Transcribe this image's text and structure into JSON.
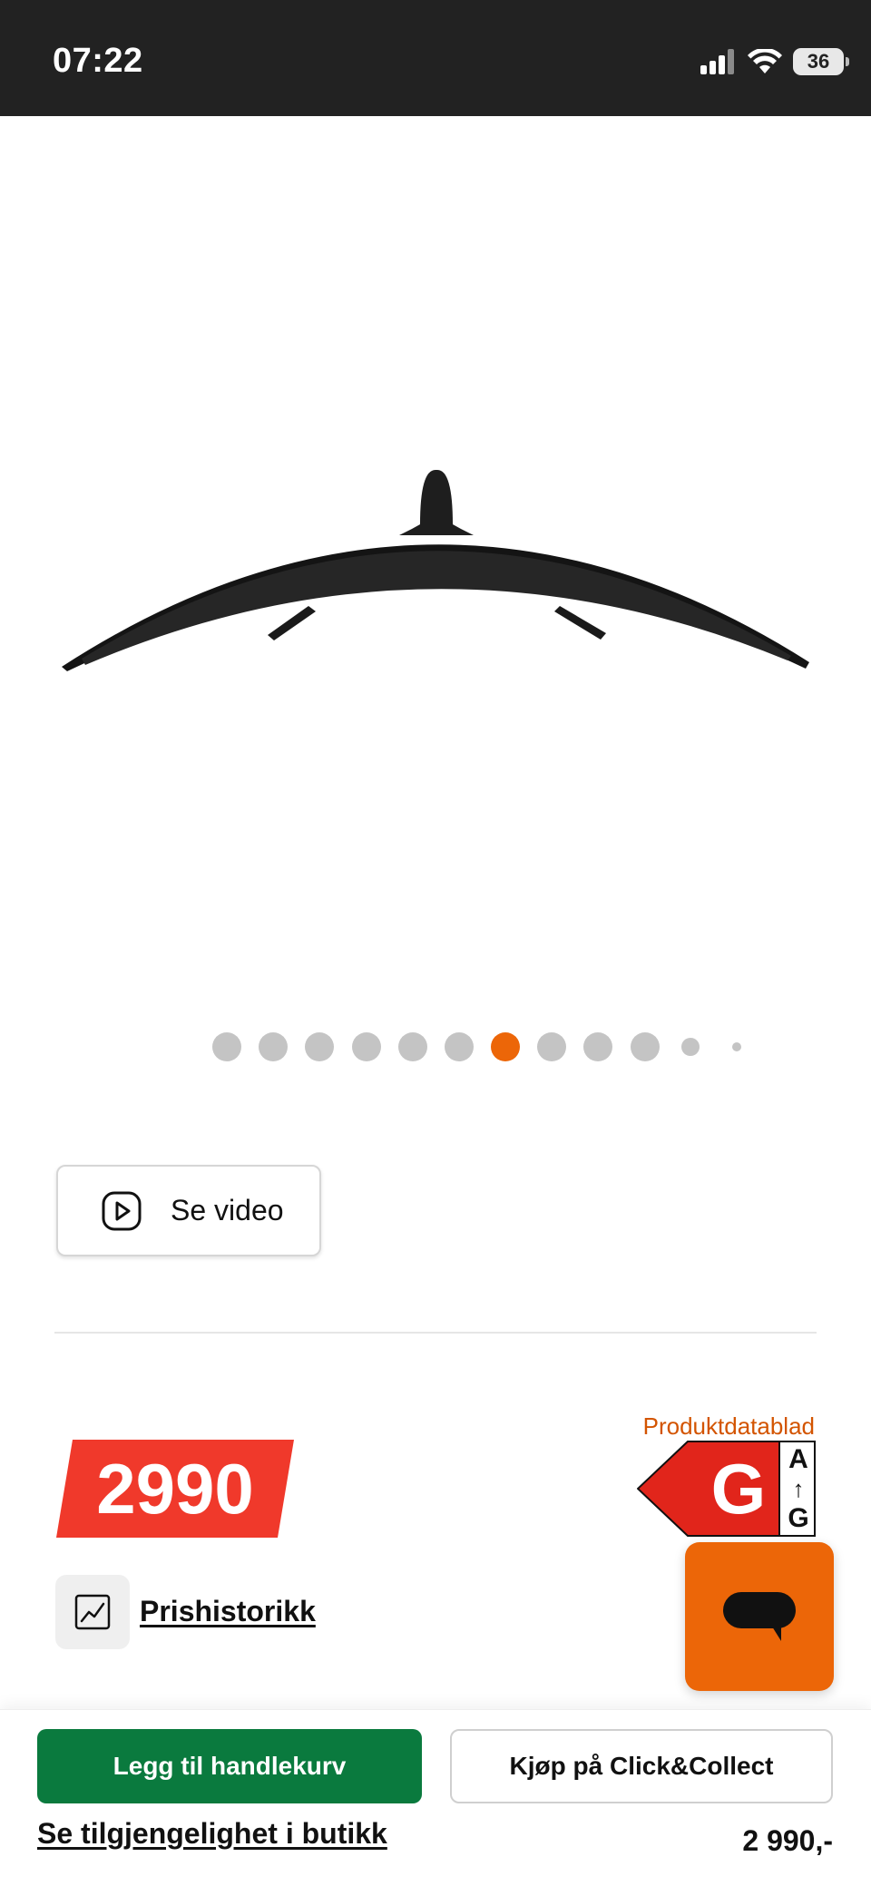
{
  "status_bar": {
    "time": "07:22",
    "battery": "36",
    "icons": [
      "signal-icon",
      "wifi-icon",
      "battery-icon"
    ]
  },
  "gallery": {
    "image": "curved-monitor-top-view",
    "dot_count": 12,
    "active_index": 6
  },
  "video_button": {
    "label": "Se video",
    "icon": "play-icon"
  },
  "price": {
    "value": "2990",
    "tag_color": "#f0392b"
  },
  "energy": {
    "datasheet_link": "Produktdatablad",
    "class": "G",
    "scale_top": "A",
    "scale_arrow": "↑",
    "scale_bottom": "G",
    "color": "#e1251b"
  },
  "price_history": {
    "label": "Prishistorikk",
    "icon": "chart-line-icon"
  },
  "chat": {
    "icon": "chat-bubble-icon",
    "color": "#ec6608"
  },
  "bottom_bar": {
    "add_to_cart": "Legg til handlekurv",
    "click_collect": "Kjøp på Click&Collect",
    "store_availability": "Se tilgjengelighet i butikk",
    "price": "2 990,-",
    "primary_color": "#0a7a3e"
  }
}
